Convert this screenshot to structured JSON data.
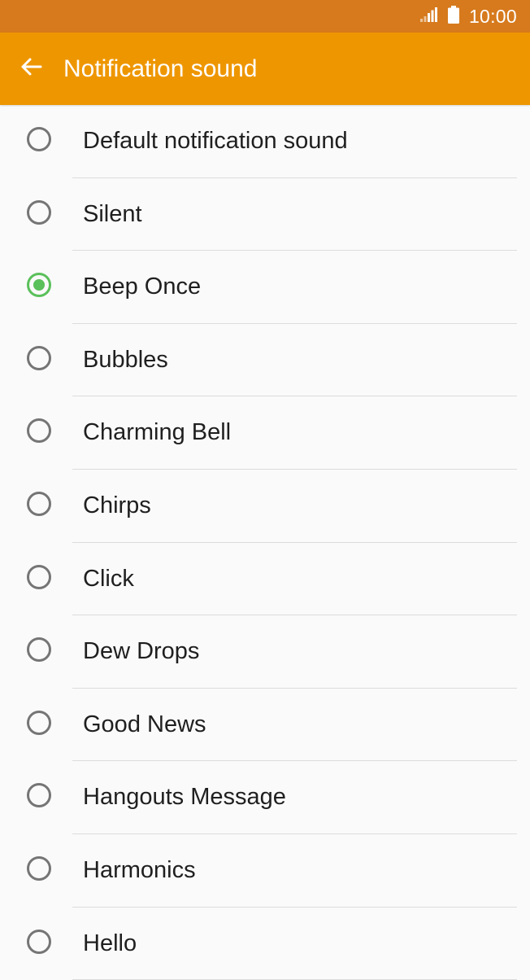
{
  "status_bar": {
    "time": "10:00",
    "signal_icon": "signal-icon",
    "battery_icon": "battery-icon"
  },
  "app_bar": {
    "title": "Notification sound",
    "back_icon": "arrow-back-icon"
  },
  "colors": {
    "status_bar": "#d67a1d",
    "app_bar": "#ee9600",
    "radio_checked": "#5ac05a",
    "radio_unchecked": "#757575"
  },
  "sounds": [
    {
      "label": "Default notification sound",
      "selected": false
    },
    {
      "label": "Silent",
      "selected": false
    },
    {
      "label": "Beep Once",
      "selected": true
    },
    {
      "label": "Bubbles",
      "selected": false
    },
    {
      "label": "Charming Bell",
      "selected": false
    },
    {
      "label": "Chirps",
      "selected": false
    },
    {
      "label": "Click",
      "selected": false
    },
    {
      "label": "Dew Drops",
      "selected": false
    },
    {
      "label": "Good News",
      "selected": false
    },
    {
      "label": "Hangouts Message",
      "selected": false
    },
    {
      "label": "Harmonics",
      "selected": false
    },
    {
      "label": "Hello",
      "selected": false
    }
  ]
}
